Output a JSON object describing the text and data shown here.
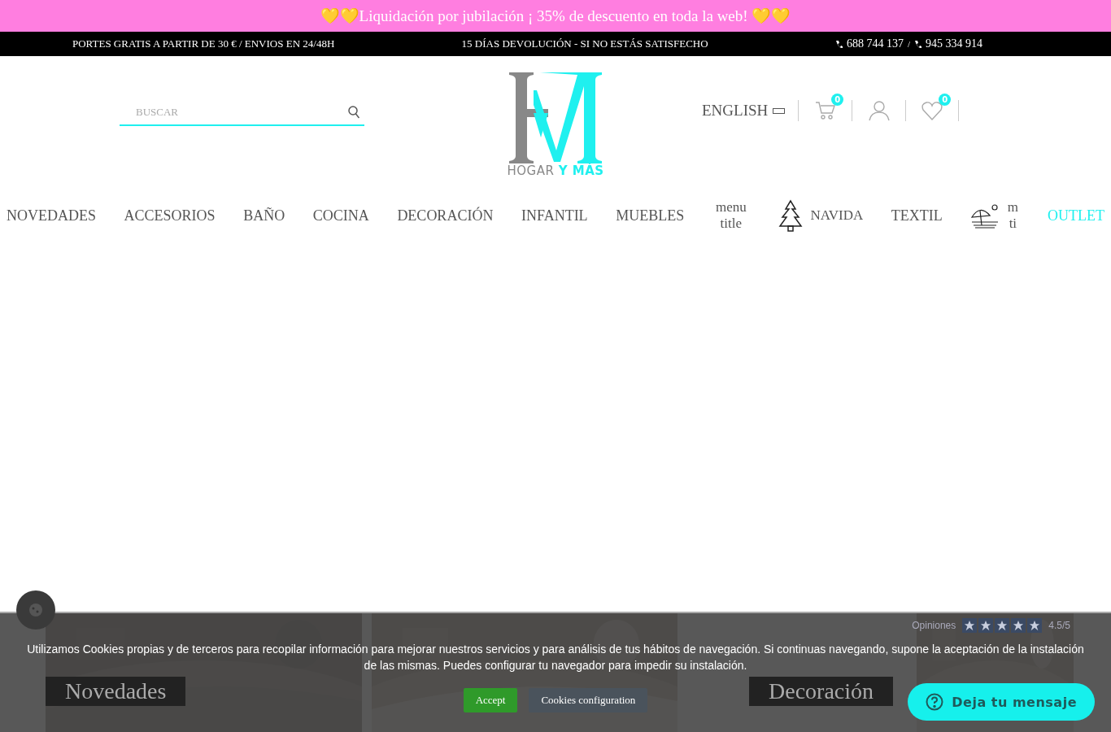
{
  "announcement": {
    "text": "💛💛Liquidación por jubilación ¡ 35% de descuento en toda la web! 💛💛"
  },
  "info_bar": {
    "shipping": "PORTES GRATIS A PARTIR DE 30 € / ENVIOS EN 24/48H",
    "returns": "15 DÍAS DEVOLUCIÓN - SI NO ESTÁS SATISFECHO",
    "phones": [
      "688 744 137",
      "945 334 914"
    ],
    "separator": "/"
  },
  "header": {
    "search": {
      "placeholder": "BUSCAR"
    },
    "logo": {
      "brand": "HOGAR",
      "accent": "Y MÁS"
    },
    "language": "ENGLISH",
    "cart_count": "0",
    "wishlist_count": "0"
  },
  "menu": [
    {
      "label": "NOVEDADES",
      "kind": "plain"
    },
    {
      "label": "ACCESORIOS",
      "kind": "plain"
    },
    {
      "label": "BAÑO",
      "kind": "plain"
    },
    {
      "label": "COCINA",
      "kind": "plain"
    },
    {
      "label": "DECORACIÓN",
      "kind": "plain"
    },
    {
      "label": "INFANTIL",
      "kind": "plain"
    },
    {
      "label": "MUEBLES",
      "kind": "plain"
    },
    {
      "label": "menu title",
      "kind": "small"
    },
    {
      "label": "NAVIDA",
      "kind": "tree"
    },
    {
      "label": "TEXTIL",
      "kind": "plain"
    },
    {
      "label": "m ti",
      "kind": "umbrella"
    },
    {
      "label": "OUTLET",
      "kind": "accent"
    }
  ],
  "categories": [
    {
      "title": "Novedades"
    },
    {
      "title": "Decoración"
    }
  ],
  "reviews_badge": {
    "title": "Opiniones",
    "score": "4.5",
    "scale": "/5",
    "stars": 5
  },
  "cookie_notice": {
    "text": "Utilizamos Cookies propias y de terceros para recopilar información para mejorar nuestros servicios y para análisis de tus hábitos de navegación. Si continuas navegando, supone la aceptación de la instalación de las mismas. Puedes configurar tu navegador para impedir su instalación.",
    "accept": "Accept",
    "configure": "Cookies configuration"
  },
  "chat_button": {
    "label": "Deja tu mensaje"
  }
}
